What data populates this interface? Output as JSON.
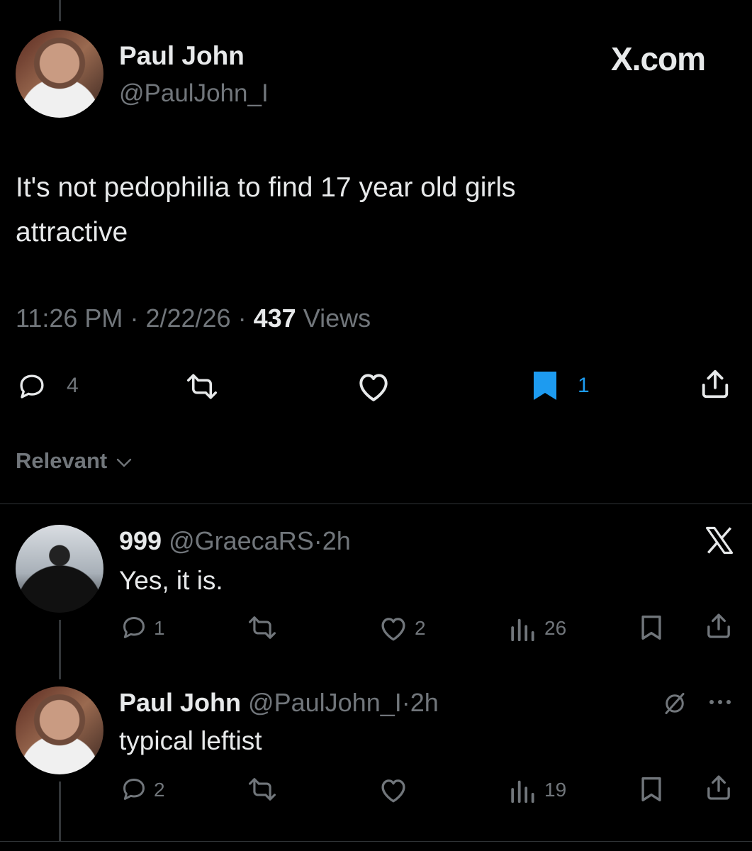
{
  "main_tweet": {
    "name": "Paul John",
    "handle": "@PaulJohn_I",
    "brand": "X.com",
    "text_line1": "It's not pedophilia to find 17 year old girls",
    "text_line2": "attractive",
    "time": "11:26 PM",
    "date": "2/22/26",
    "views_count": "437",
    "views_label": "Views",
    "reply_count": "4",
    "bookmark_count": "1"
  },
  "sort": {
    "label": "Relevant"
  },
  "replies": [
    {
      "name": "999",
      "handle": "@GraecaRS",
      "time": "2h",
      "text": "Yes, it is.",
      "reply_count": "1",
      "like_count": "2",
      "view_count": "26"
    },
    {
      "name": "Paul John",
      "handle": "@PaulJohn_I",
      "time": "2h",
      "text": "typical leftist",
      "reply_count": "2",
      "view_count": "19"
    }
  ],
  "colors": {
    "background": "#000000",
    "text": "#e7e9ea",
    "muted": "#71767b",
    "accent": "#1d9bf0"
  }
}
